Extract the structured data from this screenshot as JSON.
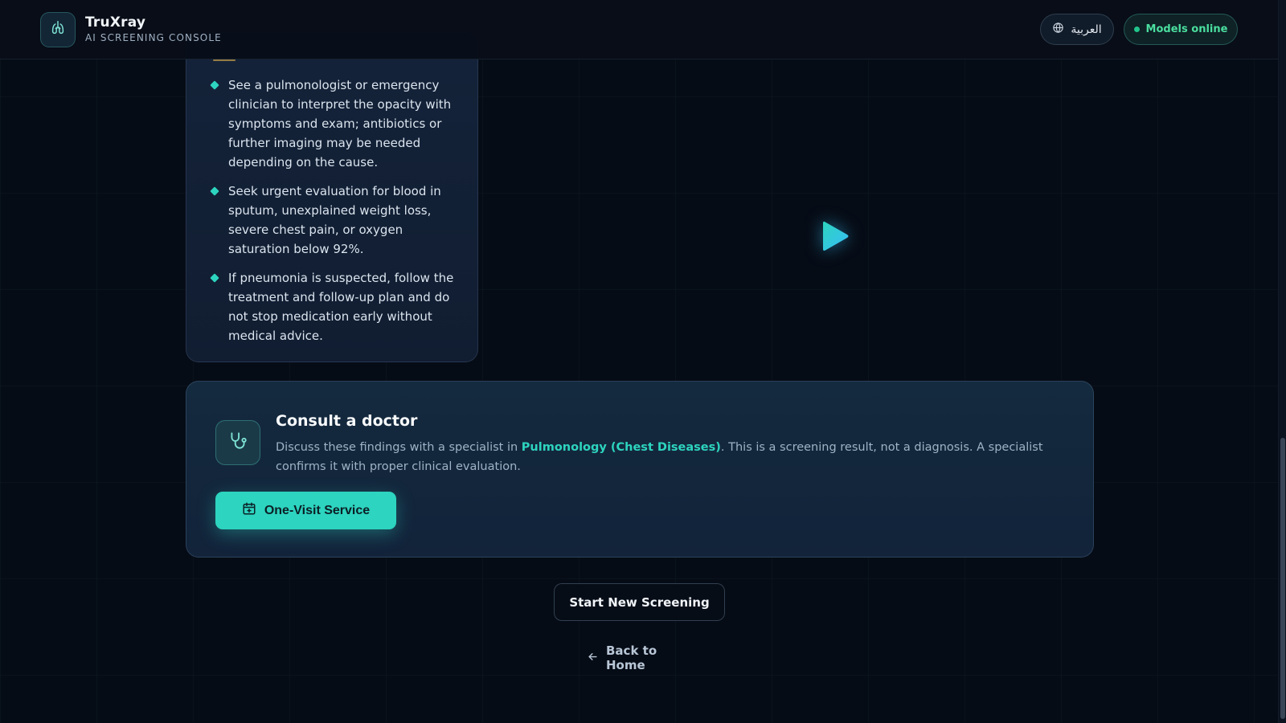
{
  "header": {
    "app_name": "TruXray",
    "app_subtitle": "AI SCREENING CONSOLE",
    "language_button": "العربية",
    "status_label": "Models online"
  },
  "recommendations": {
    "items": [
      "See a pulmonologist or emergency clinician to interpret the opacity with symptoms and exam; antibiotics or further imaging may be needed depending on the cause.",
      "Seek urgent evaluation for blood in sputum, unexplained weight loss, severe chest pain, or oxygen saturation below 92%.",
      "If pneumonia is suspected, follow the treatment and follow-up plan and do not stop medication early without medical advice."
    ]
  },
  "consult": {
    "title": "Consult a doctor",
    "desc_before": "Discuss these findings with a specialist in ",
    "specialty": "Pulmonology (Chest Diseases)",
    "desc_after": ". This is a screening result, not a diagnosis. A specialist confirms it with proper clinical evaluation.",
    "visit_button": "One-Visit Service"
  },
  "actions": {
    "new_screening": "Start New Screening",
    "back_home": "Back to Home"
  },
  "icons": {
    "logo": "lungs-icon",
    "language": "globe-icon",
    "status": "status-dot",
    "media": "play-icon",
    "consult": "stethoscope-icon",
    "visit": "calendar-plus-icon",
    "back": "arrow-left-icon",
    "bullet": "diamond-bullet"
  },
  "colors": {
    "background": "#060c16",
    "accent": "#2dd4bf",
    "status_green": "#22c58b",
    "card": "#14233a",
    "play": "#38bdf8"
  }
}
